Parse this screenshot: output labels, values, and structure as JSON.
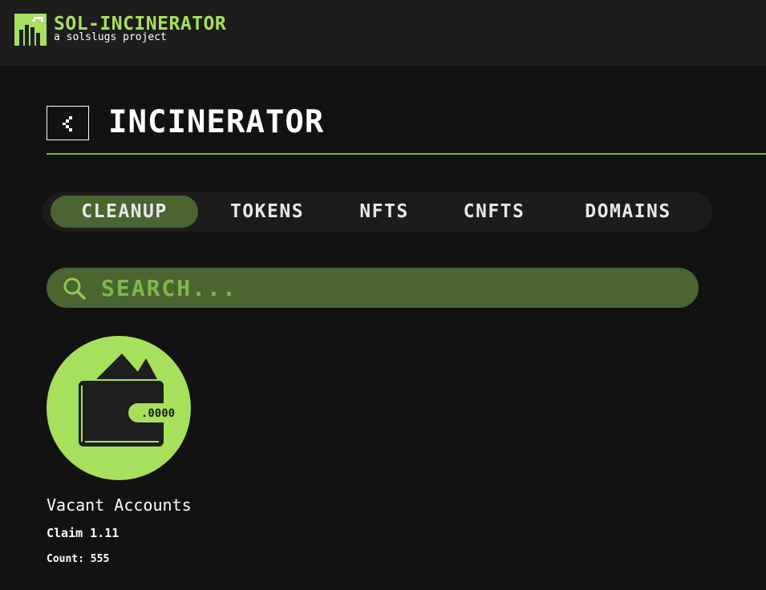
{
  "header": {
    "brand_title": "SOL-INCINERATOR",
    "brand_subtitle": "a solslugs project",
    "logo_icon": "incinerator-logo-icon"
  },
  "page": {
    "back_icon": "chevron-left-icon",
    "title": "INCINERATOR"
  },
  "tabs": [
    {
      "label": "CLEANUP",
      "active": true
    },
    {
      "label": "TOKENS",
      "active": false
    },
    {
      "label": "NFTS",
      "active": false
    },
    {
      "label": "CNFTS",
      "active": false
    },
    {
      "label": "DOMAINS",
      "active": false
    }
  ],
  "search": {
    "placeholder": "SEARCH...",
    "value": "",
    "icon": "search-icon"
  },
  "cards": [
    {
      "icon": "wallet-icon",
      "wallet_label": ".0000",
      "title": "Vacant Accounts",
      "claim": "Claim 1.11",
      "count": "Count: 555"
    }
  ],
  "colors": {
    "accent": "#a6e05c",
    "accent_dark": "#4a6530",
    "background": "#121212",
    "header_bg": "#1d1d1d"
  }
}
